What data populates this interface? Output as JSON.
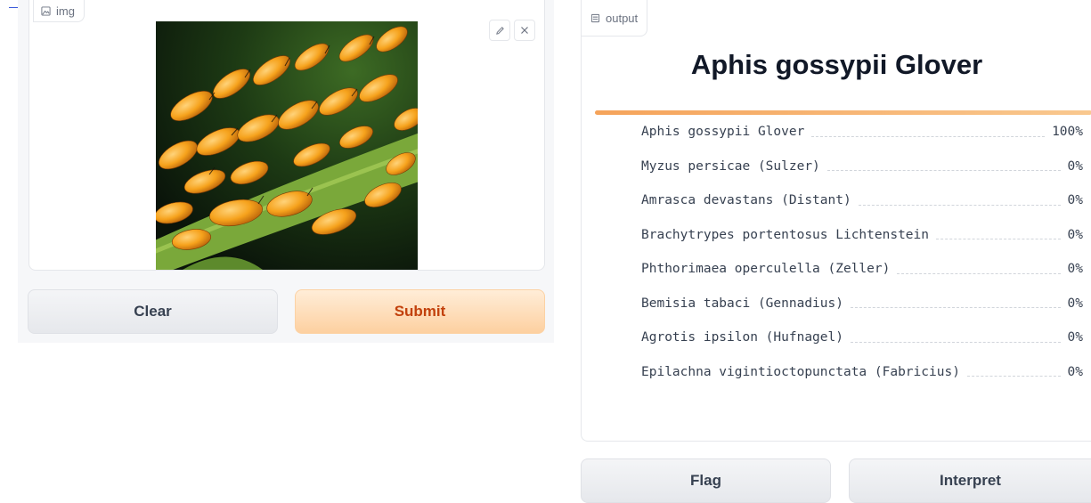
{
  "input_panel": {
    "label": "img",
    "edit_icon": "pencil-icon",
    "clear_icon": "close-icon"
  },
  "buttons": {
    "clear": "Clear",
    "submit": "Submit",
    "flag": "Flag",
    "interpret": "Interpret"
  },
  "output_panel": {
    "label": "output",
    "top_prediction": "Aphis gossypii Glover",
    "bar_color": "#f5a35a",
    "predictions": [
      {
        "name": "Aphis gossypii Glover",
        "pct": "100%",
        "value": 1.0
      },
      {
        "name": "Myzus persicae (Sulzer)",
        "pct": "0%",
        "value": 0.0
      },
      {
        "name": "Amrasca devastans (Distant)",
        "pct": "0%",
        "value": 0.0
      },
      {
        "name": "Brachytrypes portentosus Lichtenstein",
        "pct": "0%",
        "value": 0.0
      },
      {
        "name": "Phthorimaea operculella (Zeller)",
        "pct": "0%",
        "value": 0.0
      },
      {
        "name": "Bemisia tabaci (Gennadius)",
        "pct": "0%",
        "value": 0.0
      },
      {
        "name": "Agrotis ipsilon (Hufnagel)",
        "pct": "0%",
        "value": 0.0
      },
      {
        "name": "Epilachna vigintioctopunctata (Fabricius)",
        "pct": "0%",
        "value": 0.0
      }
    ]
  },
  "colors": {
    "accent": "#f97316",
    "submit_text": "#c2410c"
  }
}
